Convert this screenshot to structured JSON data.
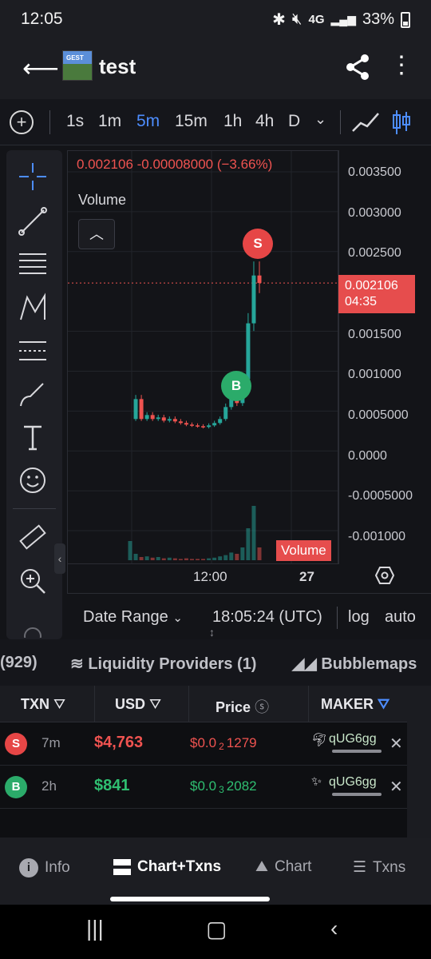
{
  "status_bar": {
    "time": "12:05",
    "network": "4G",
    "battery": "33%"
  },
  "app_bar": {
    "title": "test"
  },
  "timeframes": [
    {
      "label": "1s",
      "active": false
    },
    {
      "label": "1m",
      "active": false
    },
    {
      "label": "5m",
      "active": true
    },
    {
      "label": "15m",
      "active": false
    },
    {
      "label": "1h",
      "active": false
    },
    {
      "label": "4h",
      "active": false
    },
    {
      "label": "D",
      "active": false
    }
  ],
  "chart": {
    "ohlc_text": "0.002106  -0.00008000 (−3.66%)",
    "volume_label": "Volume",
    "volume_badge": "Volume",
    "last_price": "0.002106",
    "countdown": "04:35",
    "y_labels": [
      "0.003500",
      "0.003000",
      "0.002500",
      "0.002106",
      "0.001500",
      "0.001000",
      "0.0005000",
      "0.0000",
      "-0.0005000",
      "-0.001000"
    ],
    "x_labels": [
      "12:00",
      "27"
    ],
    "sell_marker": "S",
    "buy_marker": "B"
  },
  "chart_data": {
    "type": "line",
    "title": "",
    "xlabel": "",
    "ylabel": "",
    "y_ticks": [
      0.0035,
      0.003,
      0.0025,
      0.0015,
      0.001,
      0.0005,
      0,
      -0.0005,
      -0.001
    ],
    "x_ticks": [
      "12:00",
      "27"
    ],
    "last_price": 0.002106,
    "change": -8e-05,
    "change_pct": -3.66,
    "price_series_approx": [
      0.0004,
      0.00065,
      0.0004,
      0.00045,
      0.0004,
      0.00042,
      0.00038,
      0.0004,
      0.00037,
      0.00035,
      0.00033,
      0.00032,
      0.00031,
      0.0003,
      0.00032,
      0.00035,
      0.0004,
      0.00055,
      0.00065,
      0.0006,
      0.0009,
      0.0016,
      0.0022,
      0.002106
    ],
    "volume_series_approx": [
      0.3,
      0.1,
      0.05,
      0.06,
      0.04,
      0.05,
      0.03,
      0.04,
      0.03,
      0.02,
      0.03,
      0.02,
      0.02,
      0.02,
      0.03,
      0.04,
      0.06,
      0.08,
      0.12,
      0.1,
      0.2,
      0.5,
      0.85,
      0.2
    ]
  },
  "range_bar": {
    "date_range": "Date Range",
    "time": "18:05:24 (UTC)",
    "log": "log",
    "auto": "auto"
  },
  "tabs": {
    "txns_count": "(929)",
    "liquidity": "Liquidity Providers (1)",
    "bubblemaps": "Bubblemaps"
  },
  "table": {
    "headers": {
      "txn": "TXN",
      "usd": "USD",
      "price": "Price",
      "maker": "MAKER"
    },
    "rows": [
      {
        "side": "S",
        "age": "7m",
        "usd": "$4,763",
        "price_prefix": "$0.0",
        "price_zeros": "2",
        "price_digits": "1279",
        "maker": "qUG6gg",
        "color": "#ef5350"
      },
      {
        "side": "B",
        "age": "2h",
        "usd": "$841",
        "price_prefix": "$0.0",
        "price_zeros": "3",
        "price_digits": "2082",
        "maker": "qUG6gg",
        "color": "#2fbf71"
      }
    ]
  },
  "bottom_nav": {
    "info": "Info",
    "chart_txns": "Chart+Txns",
    "chart": "Chart",
    "txns": "Txns"
  },
  "colors": {
    "accent_blue": "#4d8dff",
    "sell": "#e64646",
    "buy": "#2bab6a"
  }
}
